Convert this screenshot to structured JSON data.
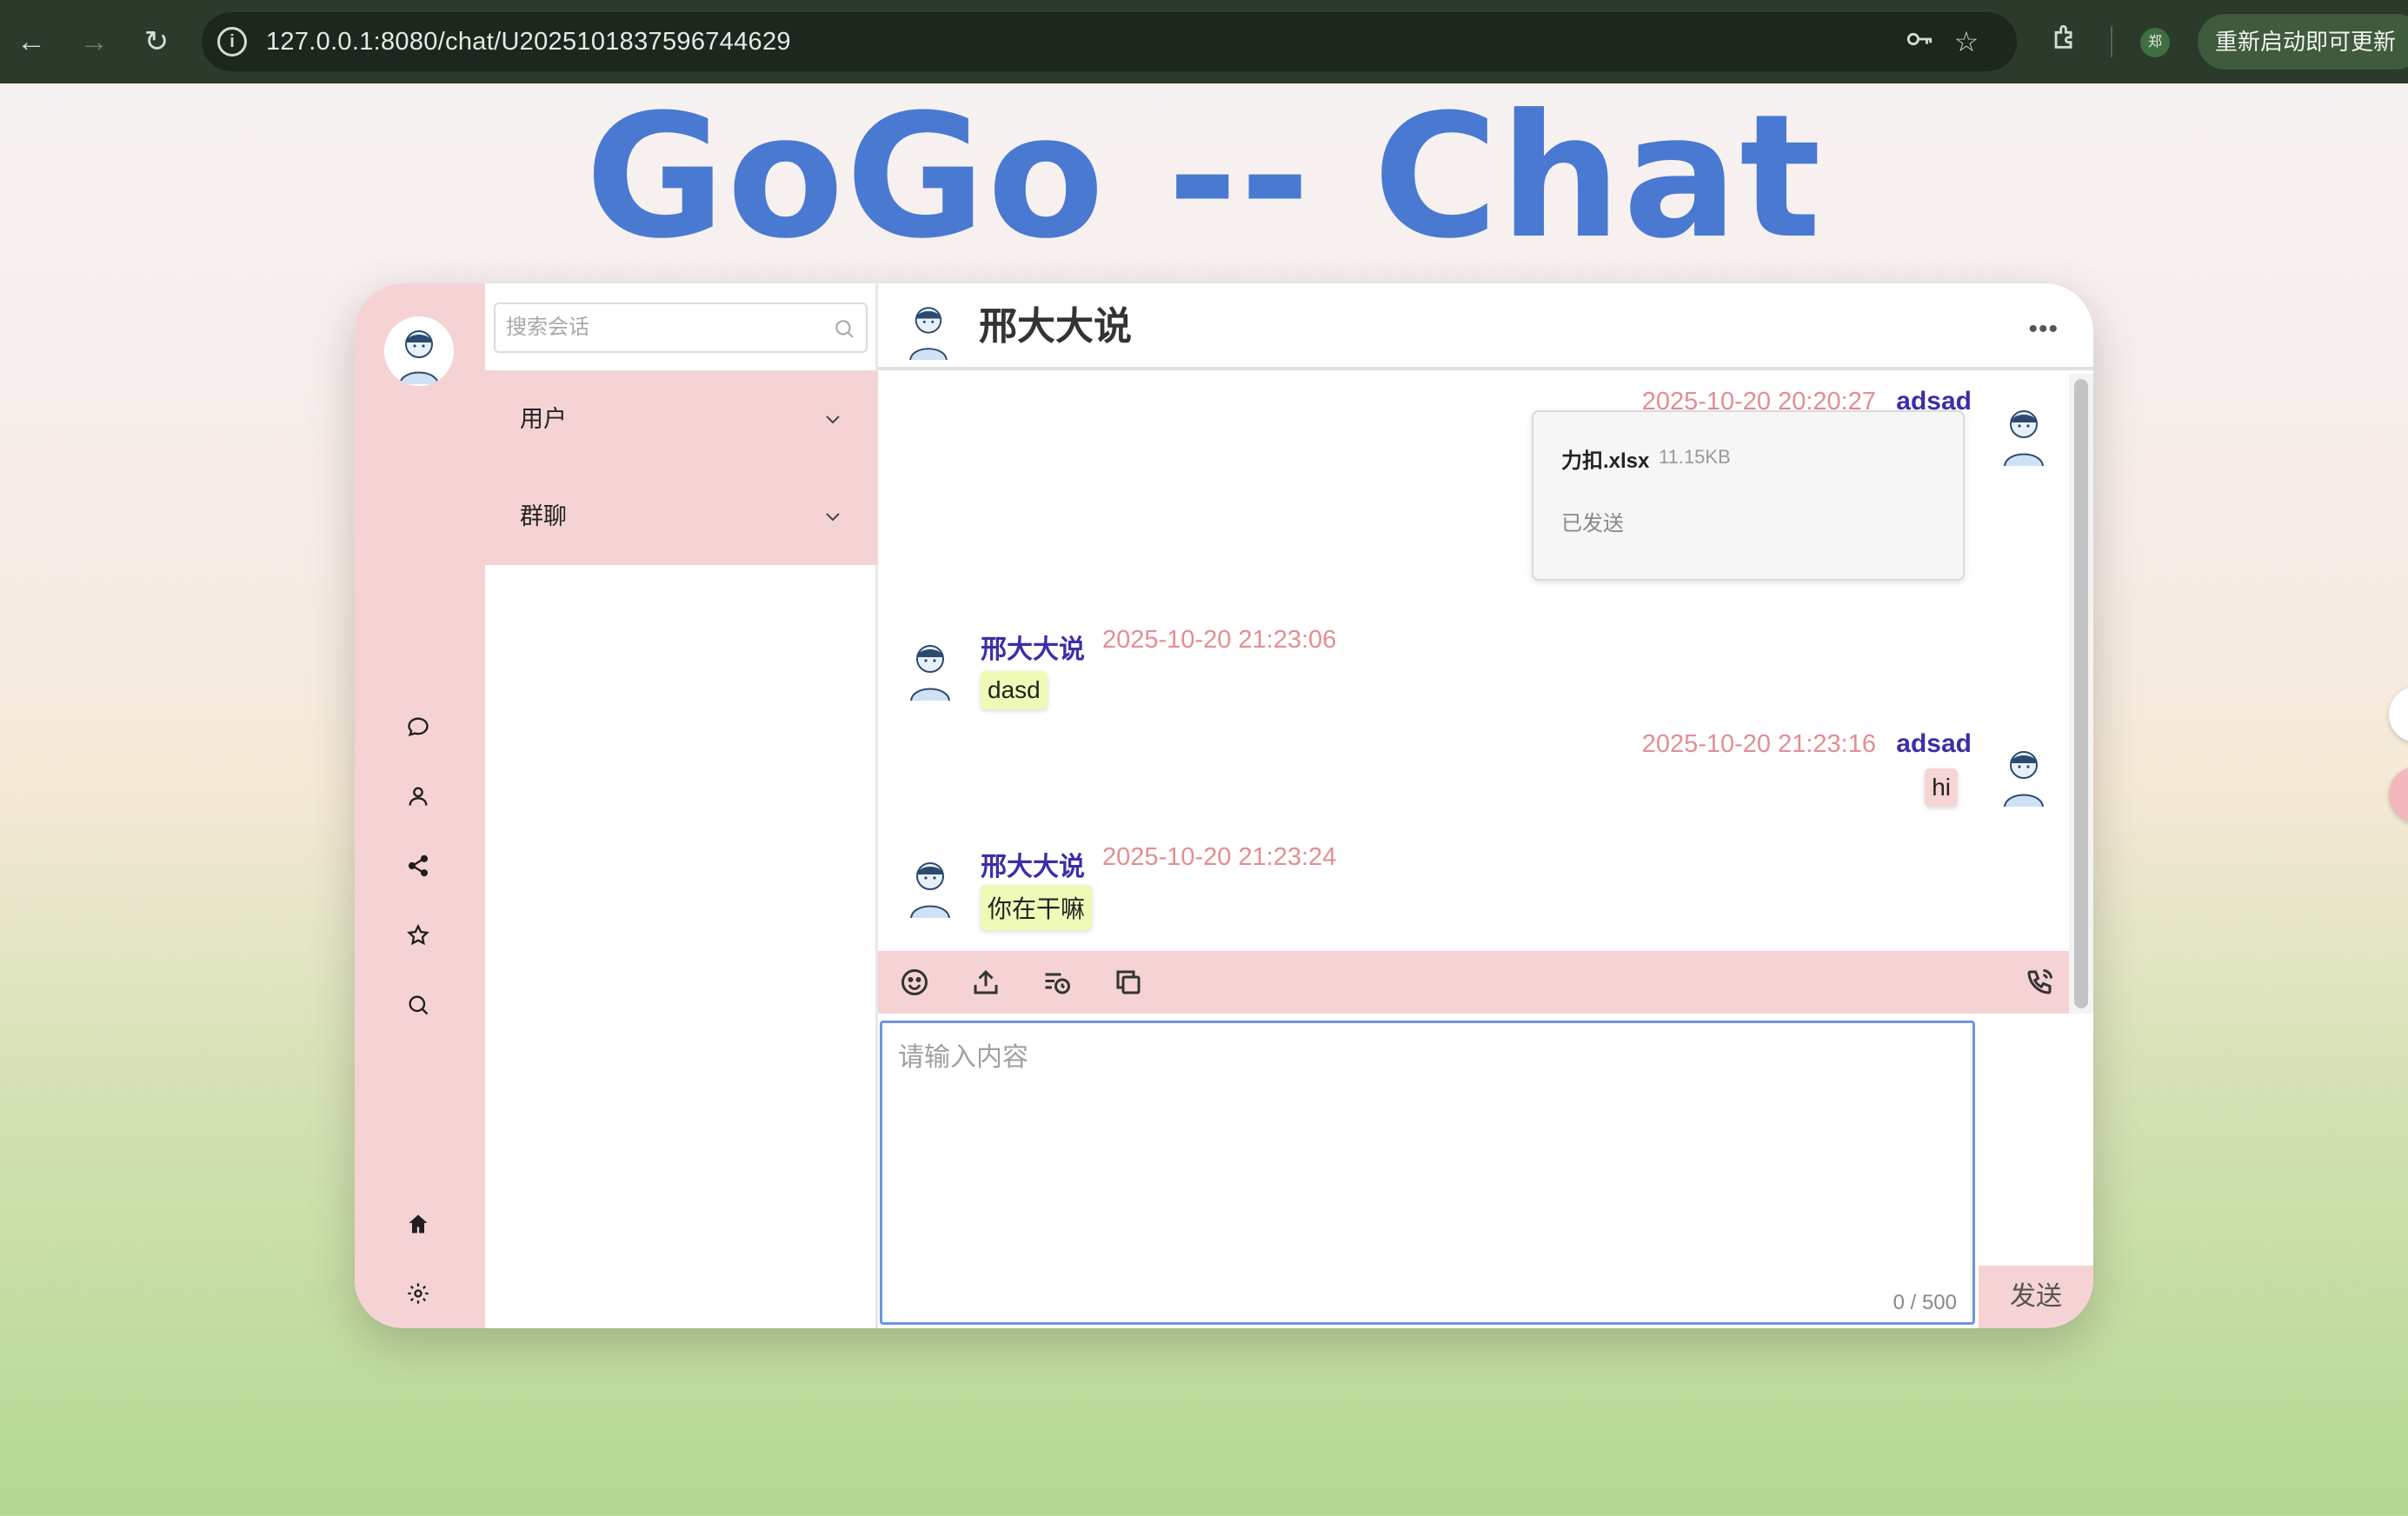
{
  "browser": {
    "url": "127.0.0.1:8080/chat/U2025101837596744629",
    "profile_initial": "郑",
    "update_label": "重新启动即可更新",
    "icons": [
      "back-icon",
      "forward-icon",
      "reload-icon",
      "info-icon",
      "key-icon",
      "star-icon",
      "extensions-icon"
    ]
  },
  "page": {
    "title": "GoGo -- Chat"
  },
  "sidebar": {
    "icons": [
      "chat-bubble-icon",
      "user-icon",
      "share-icon",
      "star-icon",
      "search-icon",
      "home-icon",
      "gear-icon"
    ]
  },
  "conversations": {
    "search_placeholder": "搜索会话",
    "groups": [
      {
        "label": "用户"
      },
      {
        "label": "群聊"
      }
    ]
  },
  "chat": {
    "title": "邢大大说",
    "messages": [
      {
        "direction": "out",
        "sender": "adsad",
        "time": "2025-10-20 20:20:27",
        "type": "file",
        "file_name": "力扣.xlsx",
        "file_size": "11.15KB",
        "status": "已发送"
      },
      {
        "direction": "in",
        "sender": "邢大大说",
        "time": "2025-10-20 21:23:06",
        "type": "text",
        "text": "dasd"
      },
      {
        "direction": "out",
        "sender": "adsad",
        "time": "2025-10-20 21:23:16",
        "type": "text",
        "text": "hi"
      },
      {
        "direction": "in",
        "sender": "邢大大说",
        "time": "2025-10-20 21:23:24",
        "type": "text",
        "text": "你在干嘛"
      }
    ],
    "toolbar_icons": [
      "emoji-icon",
      "upload-icon",
      "history-icon",
      "copy-icon",
      "call-icon"
    ],
    "input_placeholder": "请输入内容",
    "input_value": "",
    "char_count": "0 / 500",
    "send_label": "发送"
  },
  "colors": {
    "accent_pink": "#f5d3d4",
    "title_blue": "#4a79d2",
    "sender_name": "#3b2fa8",
    "timestamp": "#e28e94",
    "incoming_bubble": "#eefbb6",
    "outgoing_bubble": "#f7d4d6"
  }
}
